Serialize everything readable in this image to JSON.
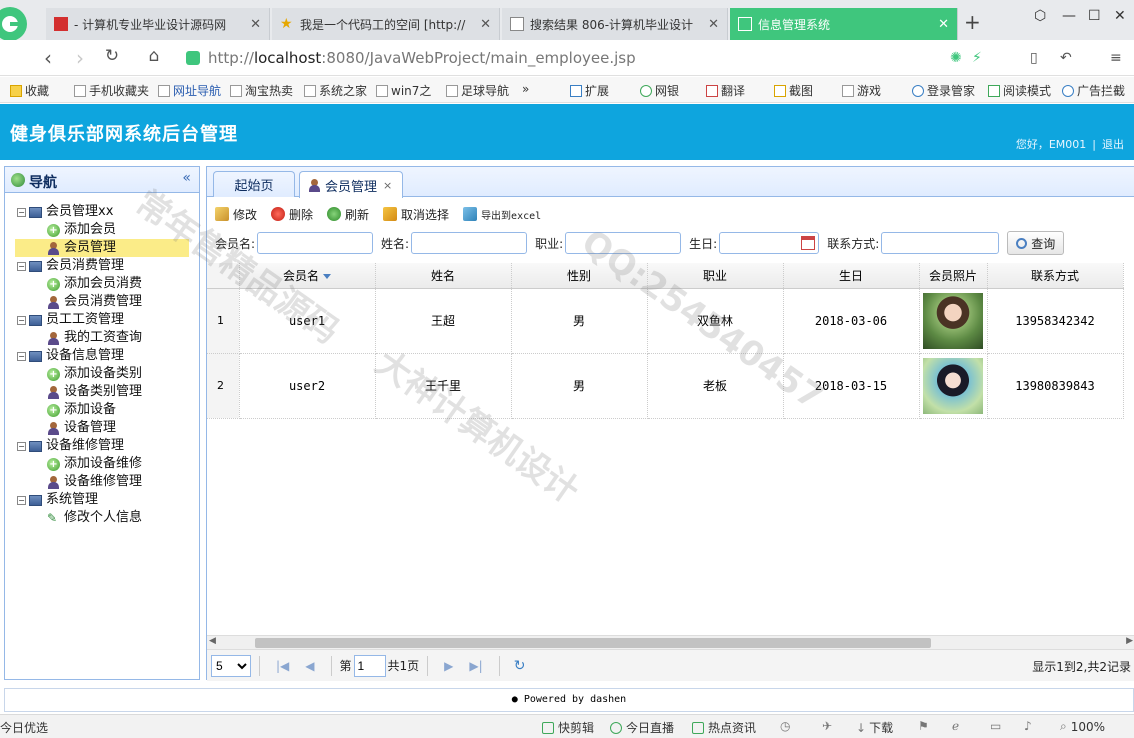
{
  "browser": {
    "tabs": [
      {
        "title": "- 计算机专业毕业设计源码网",
        "active": false
      },
      {
        "title": "我是一个代码工的空间 [http://",
        "active": false
      },
      {
        "title": "搜索结果 806-计算机毕业设计",
        "active": false
      },
      {
        "title": "信息管理系统",
        "active": true
      }
    ],
    "new_tab": "+",
    "url_prefix": "http://",
    "url_host": "localhost",
    "url_rest": ":8080/JavaWebProject/main_employee.jsp",
    "bookmarks": [
      "收藏",
      "手机收藏夹",
      "网址导航",
      "淘宝热卖",
      "系统之家",
      "win7之",
      "足球导航",
      "»",
      "扩展",
      "网银",
      "翻译",
      "截图",
      "游戏",
      "登录管家",
      "阅读模式",
      "广告拦截"
    ],
    "status": {
      "left": "今日优选",
      "items": [
        "快剪辑",
        "今日直播",
        "热点资讯",
        "下载",
        "100%"
      ]
    }
  },
  "app": {
    "title": "健身俱乐部网系统后台管理",
    "greeting": "您好，EM001",
    "logout": "退出"
  },
  "nav": {
    "title": "导航",
    "collapse": "«",
    "tree": [
      {
        "label": "会员管理xx",
        "level": 0,
        "icon": "monitor-icon"
      },
      {
        "label": "添加会员",
        "level": 1,
        "icon": "add-icon"
      },
      {
        "label": "会员管理",
        "level": 1,
        "icon": "user-icon",
        "selected": true
      },
      {
        "label": "会员消费管理",
        "level": 0,
        "icon": "monitor-icon"
      },
      {
        "label": "添加会员消费",
        "level": 1,
        "icon": "add-icon"
      },
      {
        "label": "会员消费管理",
        "level": 1,
        "icon": "user-icon"
      },
      {
        "label": "员工工资管理",
        "level": 0,
        "icon": "monitor-icon"
      },
      {
        "label": "我的工资查询",
        "level": 1,
        "icon": "user-icon"
      },
      {
        "label": "设备信息管理",
        "level": 0,
        "icon": "monitor-icon"
      },
      {
        "label": "添加设备类别",
        "level": 1,
        "icon": "add-icon"
      },
      {
        "label": "设备类别管理",
        "level": 1,
        "icon": "user-icon"
      },
      {
        "label": "添加设备",
        "level": 1,
        "icon": "add-icon"
      },
      {
        "label": "设备管理",
        "level": 1,
        "icon": "user-icon"
      },
      {
        "label": "设备维修管理",
        "level": 0,
        "icon": "monitor-icon"
      },
      {
        "label": "添加设备维修",
        "level": 1,
        "icon": "add-icon"
      },
      {
        "label": "设备维修管理",
        "level": 1,
        "icon": "user-icon"
      },
      {
        "label": "系统管理",
        "level": 0,
        "icon": "monitor-icon"
      },
      {
        "label": "修改个人信息",
        "level": 1,
        "icon": "pencil-icon"
      }
    ]
  },
  "main": {
    "tabs": [
      {
        "label": "起始页",
        "active": false
      },
      {
        "label": "会员管理",
        "active": true,
        "close": "×"
      }
    ],
    "toolbar": {
      "edit": "修改",
      "delete": "删除",
      "refresh": "刷新",
      "cancel_select": "取消选择",
      "export": "导出到excel"
    },
    "search": {
      "member_name_label": "会员名:",
      "member_name_value": "",
      "name_label": "姓名:",
      "name_value": "",
      "job_label": "职业:",
      "job_value": "",
      "birthday_label": "生日:",
      "birthday_value": "",
      "contact_label": "联系方式:",
      "contact_value": "",
      "search_button": "查询"
    },
    "grid": {
      "columns": [
        "会员名",
        "姓名",
        "性别",
        "职业",
        "生日",
        "会员照片",
        "联系方式"
      ],
      "rows": [
        {
          "num": "1",
          "member_name": "user1",
          "name": "王超",
          "gender": "男",
          "job": "双鱼林",
          "birthday": "2018-03-06",
          "phone": "13958342342"
        },
        {
          "num": "2",
          "member_name": "user2",
          "name": "王千里",
          "gender": "男",
          "job": "老板",
          "birthday": "2018-03-15",
          "phone": "13980839843"
        }
      ]
    },
    "pager": {
      "page_size": "5",
      "page_prefix": "第",
      "page_value": "1",
      "page_total": "共1页",
      "info": "显示1到2,共2记录"
    }
  },
  "footer": {
    "text": "Powered by dashen"
  },
  "watermark": {
    "qq": "QQ:254540457",
    "slogan1": "大神计算机设计",
    "slogan2": "常年售精品源码"
  },
  "colors": {
    "header_bg": "#0ea5de",
    "active_tab": "#3fc67d",
    "panel_border": "#95b8e7",
    "selected_node": "#fbec88"
  }
}
